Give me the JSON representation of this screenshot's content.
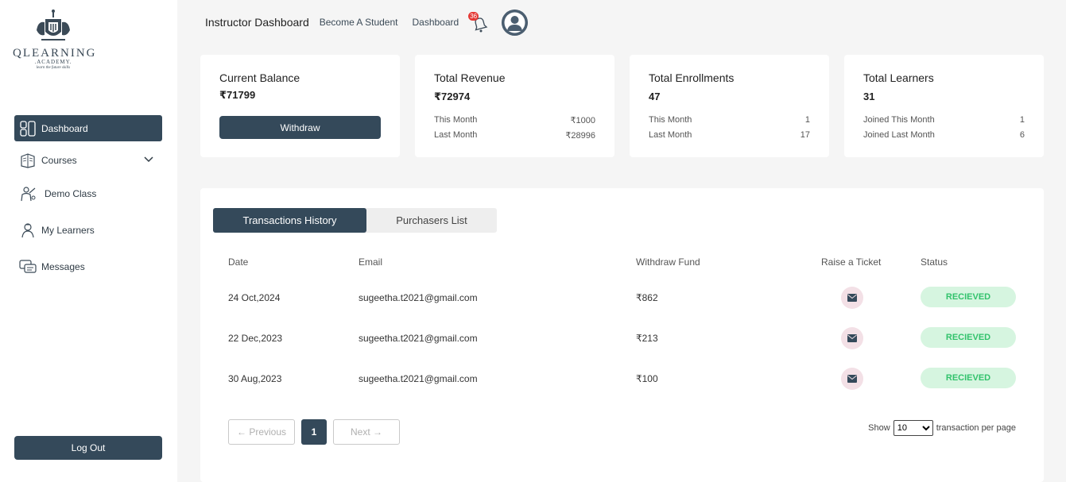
{
  "brand": {
    "name": "QLEARNING",
    "sub": ".ACADEMY.",
    "tagline": "learn the future skills"
  },
  "sidebar": {
    "items": [
      {
        "label": "Dashboard",
        "icon": "dashboard-grid-icon",
        "active": true
      },
      {
        "label": "Courses",
        "icon": "book-icon"
      },
      {
        "label": "Demo Class",
        "icon": "teacher-icon"
      },
      {
        "label": "My Learners",
        "icon": "learner-icon"
      },
      {
        "label": "Messages",
        "icon": "chat-icon"
      }
    ],
    "logout": "Log Out"
  },
  "topbar": {
    "title": "Instructor Dashboard",
    "links": [
      "Become A Student",
      "Dashboard"
    ],
    "notification_count": "36"
  },
  "cards": {
    "balance": {
      "title": "Current Balance",
      "value": "₹71799",
      "button": "Withdraw"
    },
    "revenue": {
      "title": "Total Revenue",
      "value": "₹72974",
      "rows": [
        [
          "This Month",
          "₹1000"
        ],
        [
          "Last Month",
          "₹28996"
        ]
      ]
    },
    "enrollments": {
      "title": "Total Enrollments",
      "value": "47",
      "rows": [
        [
          "This Month",
          "1"
        ],
        [
          "Last Month",
          "17"
        ]
      ]
    },
    "learners": {
      "title": "Total Learners",
      "value": "31",
      "rows": [
        [
          "Joined This Month",
          "1"
        ],
        [
          "Joined Last Month",
          "6"
        ]
      ]
    }
  },
  "tabs": [
    "Transactions History",
    "Purchasers List"
  ],
  "table": {
    "headers": [
      "Date",
      "Email",
      "Withdraw Fund",
      "Raise a Ticket",
      "Status"
    ],
    "rows": [
      {
        "date": "24 Oct,2024",
        "email": "sugeetha.t2021@gmail.com",
        "fund": "₹862",
        "status": "RECIEVED"
      },
      {
        "date": "22 Dec,2023",
        "email": "sugeetha.t2021@gmail.com",
        "fund": "₹213",
        "status": "RECIEVED"
      },
      {
        "date": "30 Aug,2023",
        "email": "sugeetha.t2021@gmail.com",
        "fund": "₹100",
        "status": "RECIEVED"
      }
    ]
  },
  "pagination": {
    "previous": "← Previous",
    "page": "1",
    "next": "Next →",
    "show_label": "Show",
    "per_page": "10",
    "per_page_label": "transaction per page"
  },
  "colors": {
    "primary": "#34495a",
    "status_bg": "#d6f5e0",
    "status_text": "#32c36c",
    "badge": "#e53935"
  }
}
